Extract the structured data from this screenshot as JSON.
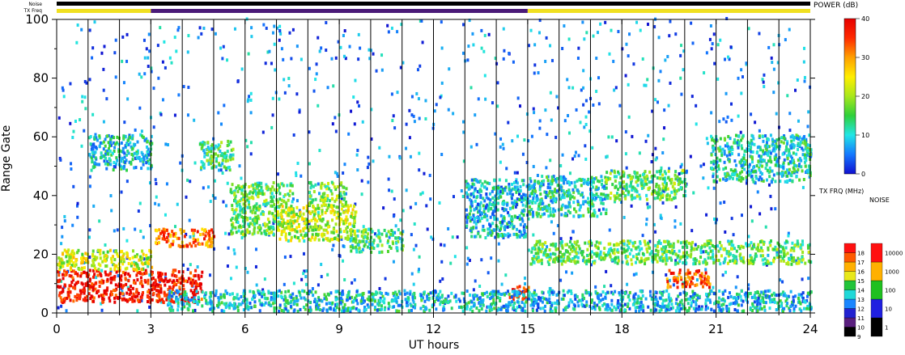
{
  "chart_data": {
    "type": "heatmap",
    "xlabel": "UT hours",
    "ylabel": "Range Gate",
    "xlim": [
      0,
      24
    ],
    "ylim": [
      0,
      100
    ],
    "xticks": [
      "0",
      "3",
      "6",
      "9",
      "12",
      "15",
      "18",
      "21",
      "24"
    ],
    "yticks": [
      "0",
      "20",
      "40",
      "60",
      "80",
      "100"
    ],
    "vertical_scan_lines_hours": [
      1,
      2,
      3,
      4,
      5,
      6,
      7,
      8,
      9,
      10,
      11,
      12,
      13,
      14,
      15,
      16,
      17,
      18,
      19,
      20,
      21,
      22,
      23
    ],
    "status_bars": {
      "noise_label": "Noise",
      "txfreq_label": "TX Freq",
      "noise_color": "#000000",
      "txfreq_segments": [
        {
          "start": 0,
          "end": 3,
          "color": "#f0e020"
        },
        {
          "start": 3,
          "end": 15,
          "color": "#4a1a78"
        },
        {
          "start": 15,
          "end": 24,
          "color": "#f0e020"
        }
      ]
    },
    "power_colorbar": {
      "title": "POWER (dB)",
      "range": [
        0,
        40
      ],
      "ticks": [
        "0",
        "10",
        "20",
        "30",
        "40"
      ],
      "stops": [
        "#1010d0",
        "#1478ff",
        "#22e6e6",
        "#2fd03a",
        "#a8e81c",
        "#ffee00",
        "#ffa000",
        "#ff2a00",
        "#e60000"
      ]
    },
    "txfrq_colorbar": {
      "title": "TX FRQ (MHz)",
      "levels": [
        "9",
        "10",
        "11",
        "12",
        "13",
        "14",
        "15",
        "16",
        "17",
        "18"
      ],
      "colors": [
        "#000000",
        "#5a1f7e",
        "#2222d0",
        "#1a86ff",
        "#20d8d8",
        "#22c43a",
        "#e8e81a",
        "#ffb000",
        "#ff5a00",
        "#ff1010"
      ]
    },
    "noise_colorbar": {
      "title": "NOISE",
      "levels": [
        "1",
        "10",
        "100",
        "1000",
        "10000"
      ],
      "colors": [
        "#000000",
        "#2020e0",
        "#20c020",
        "#ffb000",
        "#ff1010"
      ]
    },
    "echo_regions": [
      {
        "x0": 0.0,
        "x1": 4.6,
        "y0": 3,
        "y1": 14,
        "power": 38
      },
      {
        "x0": 0.0,
        "x1": 3.0,
        "y0": 14,
        "y1": 21,
        "power": 22
      },
      {
        "x0": 1.0,
        "x1": 3.0,
        "y0": 48,
        "y1": 60,
        "power": 10
      },
      {
        "x0": 3.1,
        "x1": 5.0,
        "y0": 22,
        "y1": 28,
        "power": 32
      },
      {
        "x0": 4.5,
        "x1": 5.6,
        "y0": 48,
        "y1": 58,
        "power": 14
      },
      {
        "x0": 5.5,
        "x1": 7.5,
        "y0": 26,
        "y1": 44,
        "power": 16
      },
      {
        "x0": 7.0,
        "x1": 9.5,
        "y0": 24,
        "y1": 36,
        "power": 21
      },
      {
        "x0": 8.0,
        "x1": 9.2,
        "y0": 36,
        "y1": 44,
        "power": 18
      },
      {
        "x0": 9.3,
        "x1": 11.0,
        "y0": 20,
        "y1": 28,
        "power": 14
      },
      {
        "x0": 13.0,
        "x1": 15.0,
        "y0": 25,
        "y1": 45,
        "power": 9
      },
      {
        "x0": 14.4,
        "x1": 15.0,
        "y0": 4,
        "y1": 9,
        "power": 37
      },
      {
        "x0": 3.5,
        "x1": 15.0,
        "y0": 0,
        "y1": 7,
        "power": 10
      },
      {
        "x0": 15.0,
        "x1": 24.0,
        "y0": 0,
        "y1": 7,
        "power": 9
      },
      {
        "x0": 15.0,
        "x1": 17.5,
        "y0": 32,
        "y1": 46,
        "power": 11
      },
      {
        "x0": 17.4,
        "x1": 20.0,
        "y0": 38,
        "y1": 48,
        "power": 16
      },
      {
        "x0": 15.0,
        "x1": 24.0,
        "y0": 16,
        "y1": 24,
        "power": 16
      },
      {
        "x0": 19.4,
        "x1": 20.8,
        "y0": 8,
        "y1": 14,
        "power": 34
      },
      {
        "x0": 20.8,
        "x1": 24.0,
        "y0": 44,
        "y1": 60,
        "power": 11
      }
    ]
  }
}
